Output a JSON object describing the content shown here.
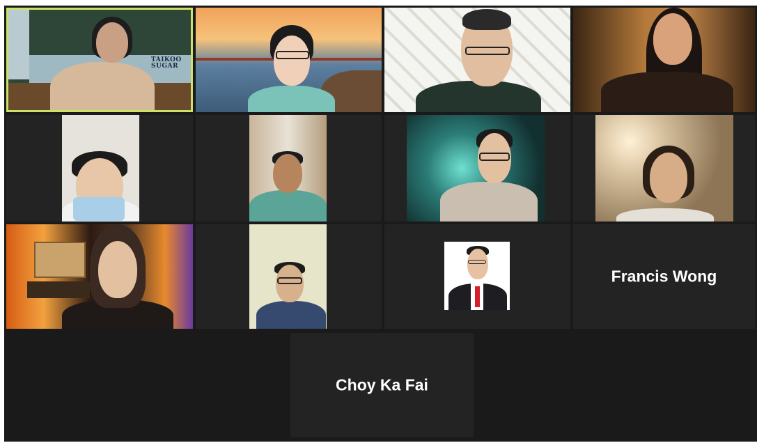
{
  "meeting": {
    "participants": [
      {
        "id": "p1",
        "name": "",
        "video": true,
        "active_speaker": true,
        "background_sign": "TAIKOO SUGAR"
      },
      {
        "id": "p2",
        "name": "",
        "video": true
      },
      {
        "id": "p3",
        "name": "",
        "video": true
      },
      {
        "id": "p4",
        "name": "",
        "video": true
      },
      {
        "id": "p5",
        "name": "",
        "video": true
      },
      {
        "id": "p6",
        "name": "",
        "video": true
      },
      {
        "id": "p7",
        "name": "",
        "video": true
      },
      {
        "id": "p8",
        "name": "",
        "video": true
      },
      {
        "id": "p9",
        "name": "",
        "video": true
      },
      {
        "id": "p10",
        "name": "",
        "video": true
      },
      {
        "id": "p11",
        "name": "",
        "video": false,
        "profile_photo": true
      },
      {
        "id": "p12",
        "name": "Francis Wong",
        "video": false
      },
      {
        "id": "p13",
        "name": "Choy Ka Fai",
        "video": false
      }
    ]
  },
  "colors": {
    "background": "#1a1a1a",
    "tile": "#232323",
    "active_speaker_border": "#c9e36a",
    "name_text": "#ffffff"
  }
}
